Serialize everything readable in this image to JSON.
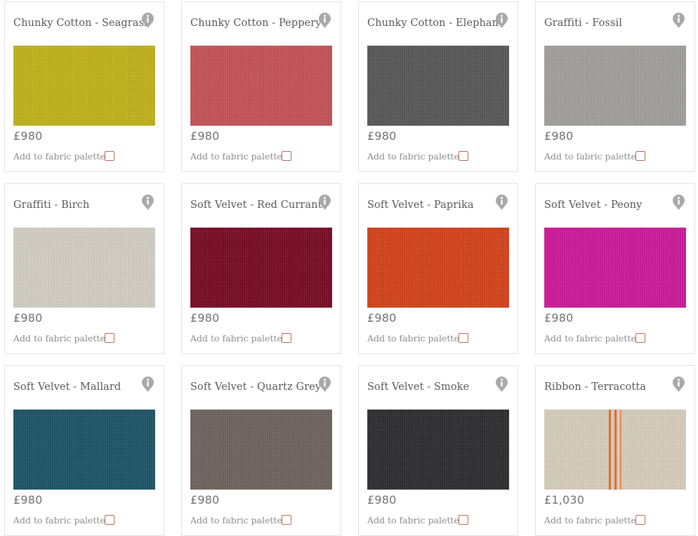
{
  "palette_label": "Add to fabric palette",
  "info_icon": "info-pin-icon",
  "accent_color": "#b86a4e",
  "fabrics": [
    {
      "name": "Chunky Cotton - Seagrass",
      "price": "£980",
      "swatch_color": "#c6b61a"
    },
    {
      "name": "Chunky Cotton - Peppery",
      "price": "£980",
      "swatch_color": "#c95459"
    },
    {
      "name": "Chunky Cotton - Elephant",
      "price": "£980",
      "swatch_color": "#5a5a5a"
    },
    {
      "name": "Graffiti - Fossil",
      "price": "£980",
      "swatch_color": "#a5a4a0"
    },
    {
      "name": "Graffiti - Birch",
      "price": "£980",
      "swatch_color": "#d8d4c9"
    },
    {
      "name": "Soft Velvet - Red Currant",
      "price": "£980",
      "swatch_color": "#7a0a24"
    },
    {
      "name": "Soft Velvet - Paprika",
      "price": "£980",
      "swatch_color": "#d9441a"
    },
    {
      "name": "Soft Velvet - Peony",
      "price": "£980",
      "swatch_color": "#d2199c"
    },
    {
      "name": "Soft Velvet - Mallard",
      "price": "£980",
      "swatch_color": "#1b5569"
    },
    {
      "name": "Soft Velvet - Quartz Grey",
      "price": "£980",
      "swatch_color": "#716660"
    },
    {
      "name": "Soft Velvet - Smoke",
      "price": "£980",
      "swatch_color": "#2e2e31"
    },
    {
      "name": "Ribbon - Terracotta",
      "price": "£1,030",
      "swatch_color": "#ddd3c0"
    }
  ]
}
